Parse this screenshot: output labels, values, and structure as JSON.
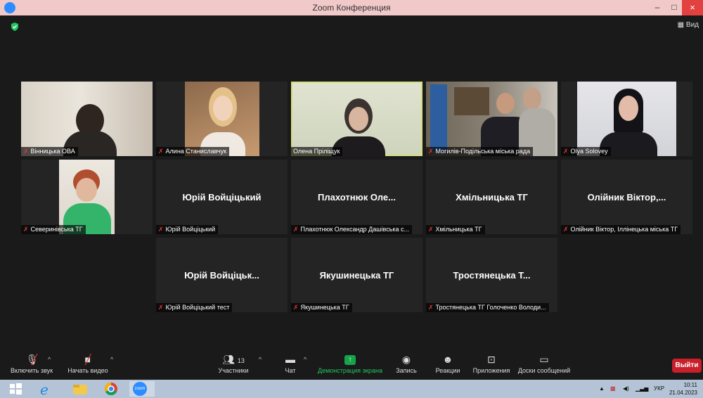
{
  "window": {
    "title": "Zoom Конференция",
    "minimize": "–",
    "maximize": "□",
    "close": "×"
  },
  "view_button": "Вид",
  "tiles": [
    {
      "label": "Вінницька ОВА",
      "name": "",
      "video": true
    },
    {
      "label": "Алина Станиславчук",
      "name": "",
      "video": true
    },
    {
      "label": "Олена Пріліщук",
      "name": "",
      "video": true,
      "active": true
    },
    {
      "label": "Могилів-Подільська міська рада",
      "name": "",
      "video": true
    },
    {
      "label": "Olya Solovey",
      "name": "",
      "video": true
    },
    {
      "label": "Северинівська ТГ",
      "name": "",
      "video": true
    },
    {
      "label": "Юрій Войціцький",
      "name": "Юрій Войціцький",
      "video": false
    },
    {
      "label": "Плахотнюк Олександр Дашівська с...",
      "name": "Плахотнюк Оле...",
      "video": false
    },
    {
      "label": "Хмільницька ТГ",
      "name": "Хмільницька ТГ",
      "video": false
    },
    {
      "label": "Олійник Віктор, Іллінецька міська ТГ",
      "name": "Олійник Віктор,...",
      "video": false
    },
    {
      "label": "Юрій Войціцький тест",
      "name": "Юрій Войціцьк...",
      "video": false
    },
    {
      "label": "Якушинецька ТГ",
      "name": "Якушинецька ТГ",
      "video": false
    },
    {
      "label": "Тростянецька ТГ Голоченко Володи...",
      "name": "Тростянецька Т...",
      "video": false
    }
  ],
  "toolbar": {
    "unmute": "Включить звук",
    "start_video": "Начать видео",
    "participants": "Участники",
    "participants_count": "13",
    "chat": "Чат",
    "share": "Демонстрация экрана",
    "record": "Запись",
    "reactions": "Реакции",
    "apps": "Приложения",
    "whiteboards": "Доски сообщений",
    "leave": "Выйти"
  },
  "taskbar": {
    "language": "УКР",
    "time": "10:11",
    "date": "21.04.2023",
    "zoom_app": "zoom"
  },
  "colors": {
    "accent": "#2d8cff",
    "active_speaker": "#d6e07a",
    "leave": "#c91f2a",
    "share": "#22c55e"
  }
}
